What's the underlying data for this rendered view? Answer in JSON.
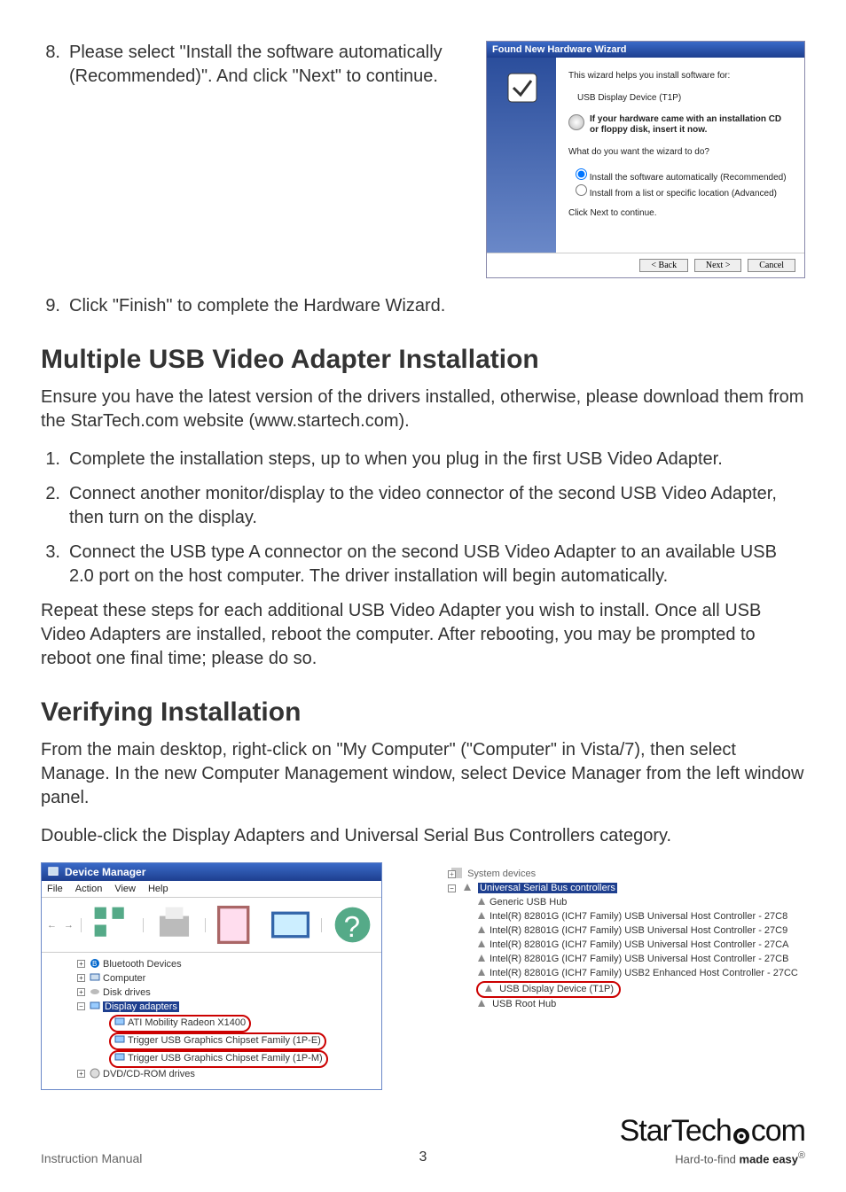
{
  "steps_a": [
    {
      "n": "8.",
      "t": "Please select \"Install the software automatically (Recommended)\". And click \"Next\" to continue."
    },
    {
      "n": "9.",
      "t": "Click \"Finish\" to complete the Hardware Wizard."
    }
  ],
  "wizard": {
    "title": "Found New Hardware Wizard",
    "intro": "This wizard helps you install software for:",
    "device": "USB Display Device (T1P)",
    "cd_msg": "If your hardware came with an installation CD or floppy disk, insert it now.",
    "question": "What do you want the wizard to do?",
    "opt1": "Install the software automatically (Recommended)",
    "opt2": "Install from a list or specific location (Advanced)",
    "click_next": "Click Next to continue.",
    "back": "< Back",
    "next": "Next >",
    "cancel": "Cancel"
  },
  "h2_multi": "Multiple USB Video Adapter Installation",
  "multi_intro": "Ensure you have the latest version of the drivers installed, otherwise, please download them from the StarTech.com website (www.startech.com).",
  "multi_steps": [
    {
      "n": "1.",
      "t": "Complete the installation steps, up to when you plug in the first USB Video Adapter."
    },
    {
      "n": "2.",
      "t": "Connect another monitor/display to the video connector of the second USB Video Adapter, then turn on the display."
    },
    {
      "n": "3.",
      "t": "Connect the USB type A connector on the second USB Video Adapter to an available USB 2.0 port on the host computer. The driver installation will begin automatically."
    }
  ],
  "multi_outro": "Repeat these steps for each additional USB Video Adapter you wish to install. Once all USB Video Adapters are installed, reboot the computer. After rebooting, you may be prompted to reboot one final time; please do so.",
  "h2_verify": "Verifying Installation",
  "verify_p1": "From the main desktop, right-click on \"My Computer\" (\"Computer\" in Vista/7), then select Manage. In the new Computer Management window, select Device Manager from the left window panel.",
  "verify_p2": "Double-click the Display Adapters and Universal Serial Bus Controllers category.",
  "dm": {
    "title": "Device Manager",
    "menu": [
      "File",
      "Action",
      "View",
      "Help"
    ],
    "tree": [
      {
        "label": "Bluetooth Devices",
        "level": 2,
        "exp": "+",
        "ic": "bt"
      },
      {
        "label": "Computer",
        "level": 2,
        "exp": "+",
        "ic": "pc"
      },
      {
        "label": "Disk drives",
        "level": 2,
        "exp": "+",
        "ic": "disk"
      },
      {
        "label": "Display adapters",
        "level": 2,
        "exp": "−",
        "ic": "disp",
        "sel": true
      },
      {
        "label": "ATI Mobility Radeon X1400",
        "level": 3,
        "ic": "disp",
        "circ": true
      },
      {
        "label": "Trigger USB Graphics Chipset Family (1P-E)",
        "level": 3,
        "ic": "disp",
        "circ": true
      },
      {
        "label": "Trigger USB Graphics Chipset Family (1P-M)",
        "level": 3,
        "ic": "disp",
        "circ": true
      },
      {
        "label": "DVD/CD-ROM drives",
        "level": 2,
        "exp": "+",
        "ic": "cd"
      }
    ]
  },
  "usb": {
    "root_peek": "System devices",
    "root": "Universal Serial Bus controllers",
    "items": [
      "Generic USB Hub",
      "Intel(R) 82801G (ICH7 Family) USB Universal Host Controller - 27C8",
      "Intel(R) 82801G (ICH7 Family) USB Universal Host Controller - 27C9",
      "Intel(R) 82801G (ICH7 Family) USB Universal Host Controller - 27CA",
      "Intel(R) 82801G (ICH7 Family) USB Universal Host Controller - 27CB",
      "Intel(R) 82801G (ICH7 Family) USB2 Enhanced Host Controller - 27CC"
    ],
    "highlight": "USB Display Device (T1P)",
    "after": "USB Root Hub"
  },
  "footer": {
    "manual": "Instruction Manual",
    "page": "3",
    "brand": "StarTech",
    "brand_suffix": "com",
    "tagline_a": "Hard-to-find ",
    "tagline_b": "made easy"
  }
}
